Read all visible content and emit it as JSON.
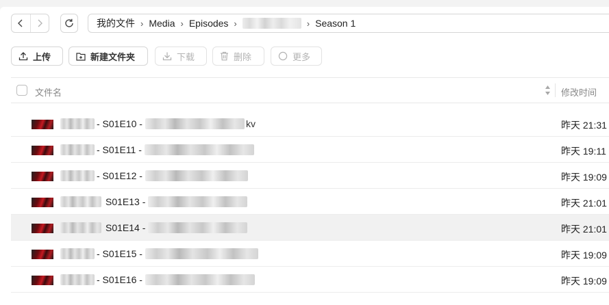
{
  "nav": {
    "back_icon": "chevron-left-icon",
    "forward_icon": "chevron-right-icon",
    "refresh_icon": "refresh-icon"
  },
  "breadcrumb": {
    "items": [
      "我的文件",
      "Media",
      "Episodes",
      "Season 1"
    ],
    "separator": "›"
  },
  "toolbar": {
    "upload": "上传",
    "new_folder": "新建文件夹",
    "download": "下载",
    "delete": "删除",
    "more": "更多"
  },
  "table": {
    "col_name": "文件名",
    "col_modified": "修改时间",
    "rows": [
      {
        "episode": "- S01E10 -",
        "ext": "kv",
        "modified": "昨天 21:31"
      },
      {
        "episode": "- S01E11 -",
        "ext": "",
        "modified": "昨天 19:11"
      },
      {
        "episode": "- S01E12 -",
        "ext": "",
        "modified": "昨天 19:09"
      },
      {
        "episode": "S01E13 -",
        "ext": "",
        "modified": "昨天 21:01"
      },
      {
        "episode": "S01E14 -",
        "ext": "",
        "modified": "昨天 21:01"
      },
      {
        "episode": "- S01E15 -",
        "ext": "",
        "modified": "昨天 19:09"
      },
      {
        "episode": "- S01E16 -",
        "ext": "",
        "modified": "昨天 19:09"
      }
    ]
  },
  "colors": {
    "background": "#f3f3f3",
    "panel": "#ffffff",
    "border": "#d6d6d6",
    "row_highlight": "#f1f1f1",
    "thumbnail_red": "#c51a22"
  }
}
